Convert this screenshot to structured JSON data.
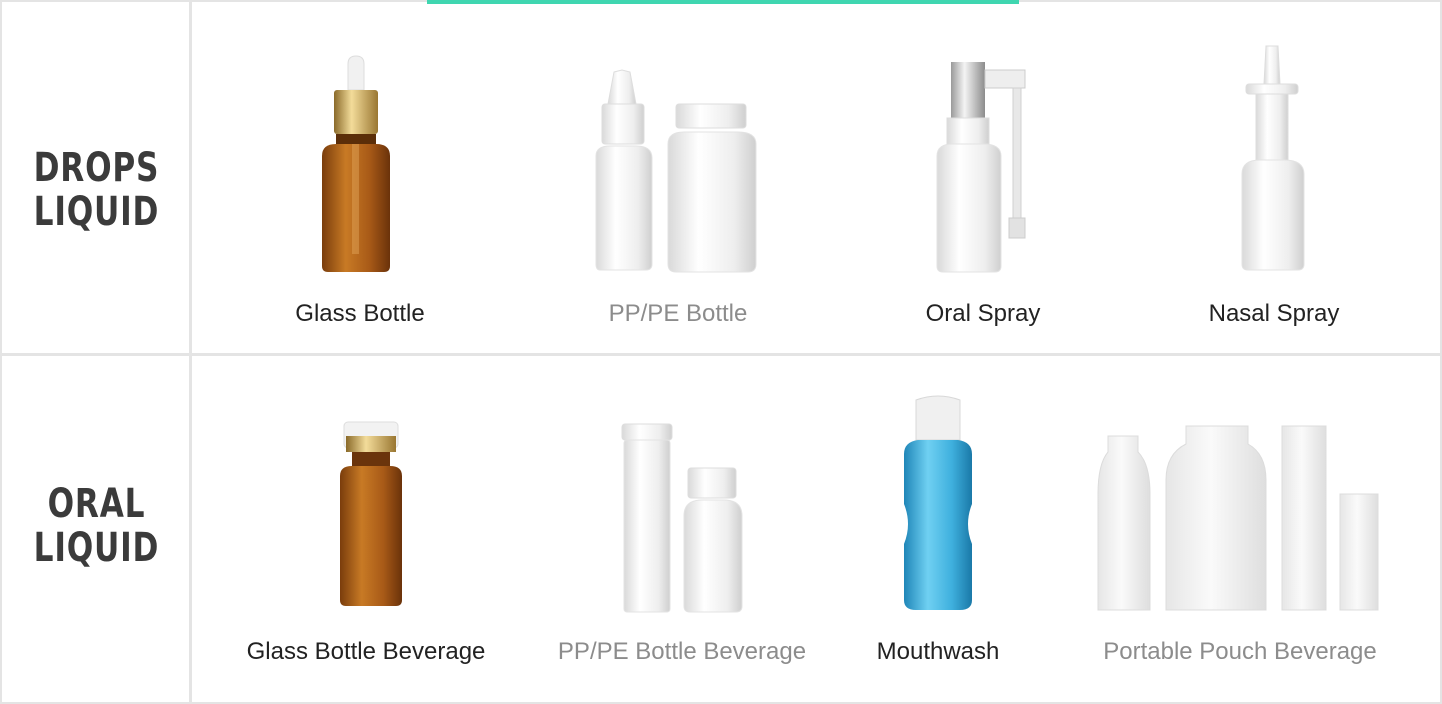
{
  "accent_color": "#3fd6b0",
  "rows": [
    {
      "title_line1": "DROPS",
      "title_line2": "LIQUID",
      "items": [
        {
          "label": "Glass Bottle",
          "icon": "amber-dropper-bottle-icon"
        },
        {
          "label": "PP/PE Bottle",
          "icon": "white-plastic-bottles-icon"
        },
        {
          "label": "Oral Spray",
          "icon": "oral-spray-bottle-icon"
        },
        {
          "label": "Nasal Spray",
          "icon": "nasal-spray-bottle-icon"
        }
      ]
    },
    {
      "title_line1": "ORAL",
      "title_line2": "LIQUID",
      "items": [
        {
          "label": "Glass Bottle Beverage",
          "icon": "amber-vial-icon"
        },
        {
          "label": "PP/PE Bottle Beverage",
          "icon": "white-tube-and-bottle-icon"
        },
        {
          "label": "Mouthwash",
          "icon": "blue-mouthwash-bottle-icon"
        },
        {
          "label": "Portable Pouch Beverage",
          "icon": "pouch-sachets-icon"
        }
      ]
    }
  ]
}
